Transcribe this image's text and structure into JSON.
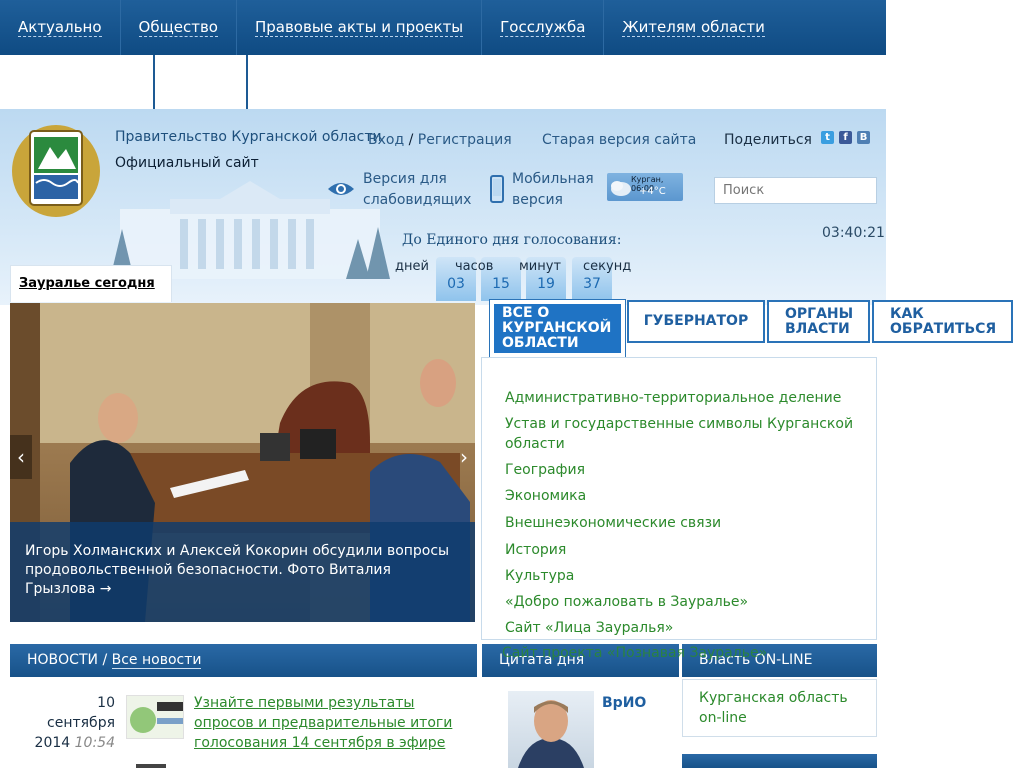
{
  "nav": {
    "items": [
      "Актуально",
      "Общество",
      "Правовые акты и проекты",
      "Госслужба",
      "Жителям области"
    ]
  },
  "header": {
    "title": "Правительство Курганской области",
    "subtitle": "Официальный сайт",
    "login": "Вход",
    "login_sep": "/",
    "register": "Регистрация",
    "old_version": "Старая версия сайта",
    "share": "Поделиться",
    "blind_version": "Версия для слабовидящих",
    "mobile_version": "Мобильная версия",
    "weather_city": "Курган, 06:00",
    "weather_temp": "+4°C",
    "search_placeholder": "Поиск",
    "clock": "03:40:21"
  },
  "countdown": {
    "title": "До Единого дня голосования:",
    "days_label": "дней",
    "hours_label": "часов",
    "hours": "03",
    "minutes_label": "минут",
    "minutes": "15",
    "seconds_label": "секунд",
    "seconds": "19",
    "extra": "37"
  },
  "slider": {
    "tab": "Зауралье сегодня",
    "caption": "Игорь Холманских и Алексей Кокорин обсудили вопросы продовольственной безопасности. Фото Виталия Грызлова →"
  },
  "tabs": [
    {
      "label": "ВСЕ О КУРГАНСКОЙ ОБЛАСТИ"
    },
    {
      "label": "ГУБЕРНАТОР"
    },
    {
      "label": "ОРГАНЫ ВЛАСТИ"
    },
    {
      "label": "КАК ОБРАТИТЬСЯ"
    }
  ],
  "region_links": [
    "Административно-территориальное деление",
    "Устав и государственные символы Курганской области",
    "География",
    "Экономика",
    "Внешнеэкономические связи",
    "История",
    "Культура",
    "«Добро пожаловать в Зауралье»",
    "Сайт «Лица Зауралья»"
  ],
  "overflow_link": "Сайт проекта «Познавая Зауралье»",
  "news": {
    "title": "НОВОСТИ",
    "sep": "/",
    "all": "Все новости",
    "item": {
      "day": "10",
      "month": "сентября",
      "year": "2014",
      "time": "10:54",
      "text": "Узнайте первыми результаты опросов и предварительные итоги голосования 14 сентября в эфире"
    }
  },
  "quote": {
    "title": "Цитата дня",
    "author": "ВрИО"
  },
  "online": {
    "title": "Власть ON-LINE",
    "link": "Курганская область on-line"
  },
  "colors": {
    "nav_bg": "#175289",
    "link_green": "#2c8a2c",
    "tab_active": "#1f73c4"
  }
}
